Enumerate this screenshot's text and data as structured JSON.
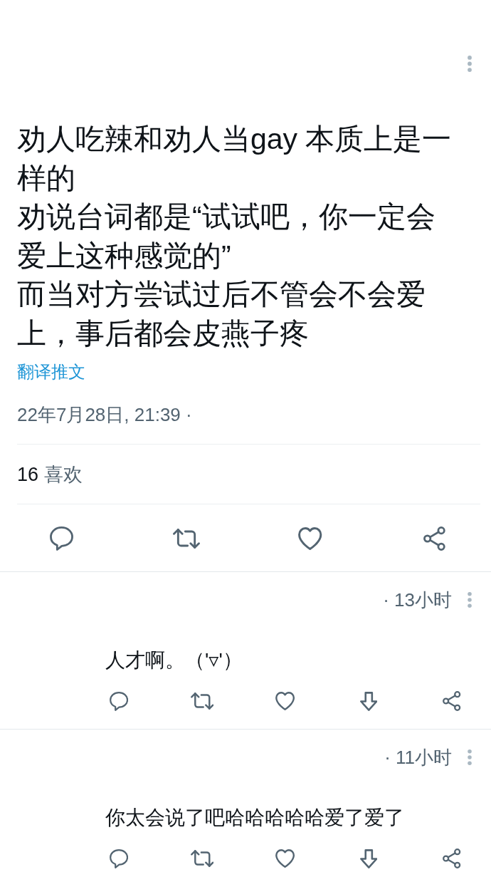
{
  "tweet": {
    "paragraphs": [
      "劝人吃辣和劝人当gay 本质上是一样的",
      "劝说台词都是“试试吧，你一定会爱上这种感觉的”",
      "而当对方尝试过后不管会不会爱上，事后都会皮燕子疼"
    ],
    "translate_link": "翻译推文",
    "timestamp": "22年7月28日, 21:39 ·",
    "likes": {
      "count": "16",
      "label": "喜欢"
    },
    "actions": [
      {
        "kind": "reply"
      },
      {
        "kind": "retweet"
      },
      {
        "kind": "like"
      },
      {
        "kind": "share"
      }
    ]
  },
  "replies": [
    {
      "time": "· 13小时",
      "text": "人才啊。（'▿'）",
      "actions": [
        {
          "kind": "reply"
        },
        {
          "kind": "retweet"
        },
        {
          "kind": "like"
        },
        {
          "kind": "download"
        },
        {
          "kind": "share"
        }
      ]
    },
    {
      "time": "· 11小时",
      "text": "你太会说了吧哈哈哈哈哈爱了爱了",
      "actions": [
        {
          "kind": "reply"
        },
        {
          "kind": "retweet"
        },
        {
          "kind": "like"
        },
        {
          "kind": "download"
        },
        {
          "kind": "share"
        }
      ]
    }
  ]
}
